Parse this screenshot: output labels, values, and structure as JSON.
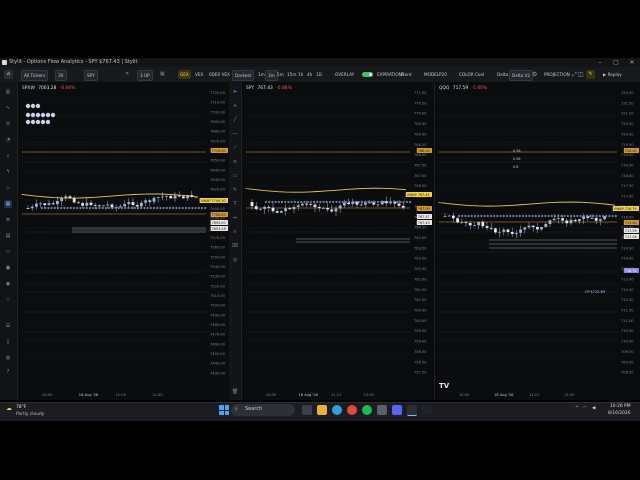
{
  "window": {
    "title": "Stylit - Options Flow Analytics - SPY $767.43 | Stylit"
  },
  "toolbar": {
    "tickers": "All Tickers",
    "ticker_count": "3X",
    "symbol": "SPY",
    "layout": "3 UP",
    "gex_label": "GEX",
    "vex_label": "VEX",
    "dex_label": "0DE0 VEX",
    "dark_label": "Darkest",
    "timeframes": [
      "1m",
      "3m",
      "5m",
      "15m",
      "1h",
      "4h",
      "1D"
    ],
    "overlay_label": "OVERLAY",
    "expirations_label": "EXPIRATIONS",
    "front_label": "Front",
    "model_label": "MODEL",
    "model_value": "P20",
    "color_label": "COLOR",
    "color_value": "Cool",
    "delta_label": "Delta",
    "delta_value": "Delta V2",
    "projection_label": "PROJECTION",
    "replay_label": "Replay"
  },
  "panels": [
    {
      "symbol": "SPXW",
      "price": "7003.28",
      "change": "-0.66%",
      "yticks": [
        "7720.00",
        "7710.00",
        "7700.00",
        "7690.00",
        "7680.00",
        "7670.00",
        "7660.00",
        "7650.00",
        "7640.00",
        "7630.00",
        "7620.00",
        "7610.00",
        "7600.00",
        "7590.00",
        "7580.00",
        "7570.00",
        "7560.00",
        "7550.00",
        "7540.00",
        "7530.00",
        "7520.00",
        "7510.00",
        "7500.00",
        "7490.00",
        "7480.00",
        "7470.00",
        "7460.00",
        "7450.00",
        "7440.00",
        "7430.00"
      ],
      "xticks": [
        "10:00",
        "16 Aug '26",
        "11:26",
        "12:30"
      ],
      "tags": [
        {
          "text": "7710.00",
          "kind": "orange"
        },
        {
          "text": "VWAP 7704.30",
          "kind": "yellow"
        },
        {
          "text": "7700.00",
          "kind": "orange"
        },
        {
          "text": "7695.00",
          "kind": "white"
        },
        {
          "text": "7693.28",
          "kind": "white"
        }
      ]
    },
    {
      "symbol": "SPY",
      "price": "767.43",
      "change": "-0.86%",
      "yticks": [
        "771.00",
        "770.50",
        "770.00",
        "769.50",
        "769.00",
        "768.50",
        "768.00",
        "767.50",
        "767.00",
        "766.50",
        "766.00",
        "765.50",
        "765.00",
        "764.50",
        "764.00",
        "763.50",
        "763.00",
        "762.50",
        "762.00",
        "761.50",
        "761.00",
        "760.50",
        "760.00",
        "759.50",
        "759.00",
        "758.50",
        "758.00",
        "757.50"
      ],
      "xticks": [
        "10:30",
        "16 Aug '26",
        "11:21",
        "13:30"
      ],
      "tags": [
        {
          "text": "768.00",
          "kind": "orange"
        },
        {
          "text": "VWAP 767.43",
          "kind": "yellow"
        },
        {
          "text": "767.00",
          "kind": "orange"
        },
        {
          "text": "767.57",
          "kind": "white"
        },
        {
          "text": "767.43",
          "kind": "white"
        }
      ]
    },
    {
      "symbol": "QQQ",
      "price": "717.59",
      "change": "-1.60%",
      "yticks": [
        "722.00",
        "721.50",
        "721.00",
        "720.50",
        "720.00",
        "719.50",
        "719.00",
        "718.50",
        "718.00",
        "717.50",
        "717.00",
        "716.50",
        "716.00",
        "715.50",
        "715.00",
        "714.50",
        "714.00",
        "713.50",
        "713.00",
        "712.50",
        "712.00",
        "711.50",
        "711.00",
        "710.50",
        "710.00",
        "709.50",
        "709.00",
        "708.50"
      ],
      "xticks": [
        "10:00",
        "16 Aug '26",
        "11:21",
        "13:30"
      ],
      "levels": [
        "0.36",
        "0.56",
        "0.6"
      ],
      "tags": [
        {
          "text": "720.00",
          "kind": "orange"
        },
        {
          "text": "VWAP 716.79",
          "kind": "yellow"
        },
        {
          "text": "717.00",
          "kind": "orange"
        },
        {
          "text": "717.59",
          "kind": "white"
        },
        {
          "text": "717.04",
          "kind": "white"
        },
        {
          "text": "716.72",
          "kind": "purple"
        }
      ],
      "cp_label": "CP $725.4M"
    }
  ],
  "sidebar": {
    "trade_label": "Trade"
  },
  "taskbar": {
    "weather_temp": "78°F",
    "weather_text": "Partly cloudy",
    "search_placeholder": "Search",
    "time": "10:26 PM",
    "date": "8/16/2026"
  },
  "colors": {
    "up": "#9fb3d9",
    "down": "#8f95a0",
    "vwap": "#e2c94d",
    "accent": "#f2d14a",
    "level_orange": "#d39a2c",
    "level_purple": "#8b84e8"
  }
}
